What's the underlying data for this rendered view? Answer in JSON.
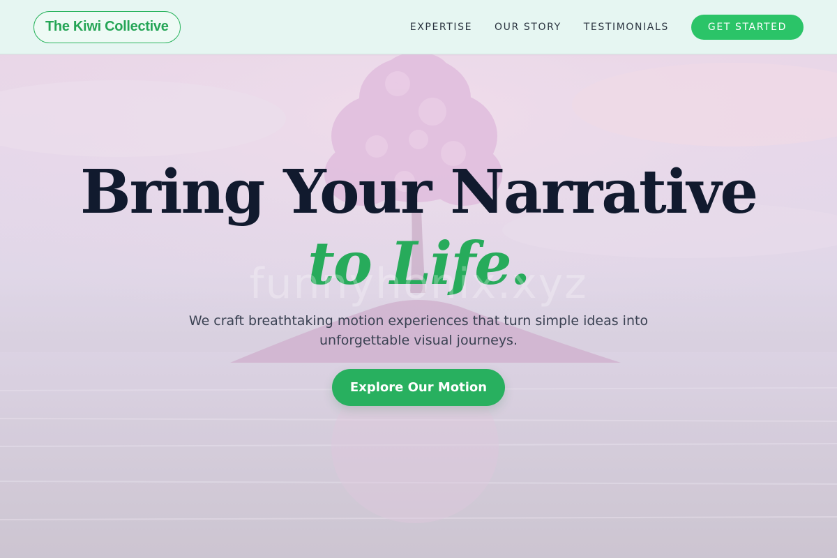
{
  "nav": {
    "logo_text": "The Kiwi Collective",
    "links": [
      "EXPERTISE",
      "OUR STORY",
      "TESTIMONIALS"
    ],
    "cta_label": "GET STARTED"
  },
  "hero": {
    "title_line1": "Bring Your Narrative",
    "title_line2": "to Life.",
    "subtitle": "We craft breathtaking motion experiences that turn simple ideas into unforgettable visual journeys.",
    "cta_label": "Explore Our Motion",
    "watermark": "funnyhonix.xyz",
    "background_image": "pink-blossom-tree-island-on-calm-water"
  },
  "colors": {
    "accent": "#2bc468",
    "accent_dark": "#27ab5b",
    "title": "#111a2e",
    "nav_bg": "#e6f6f2"
  }
}
